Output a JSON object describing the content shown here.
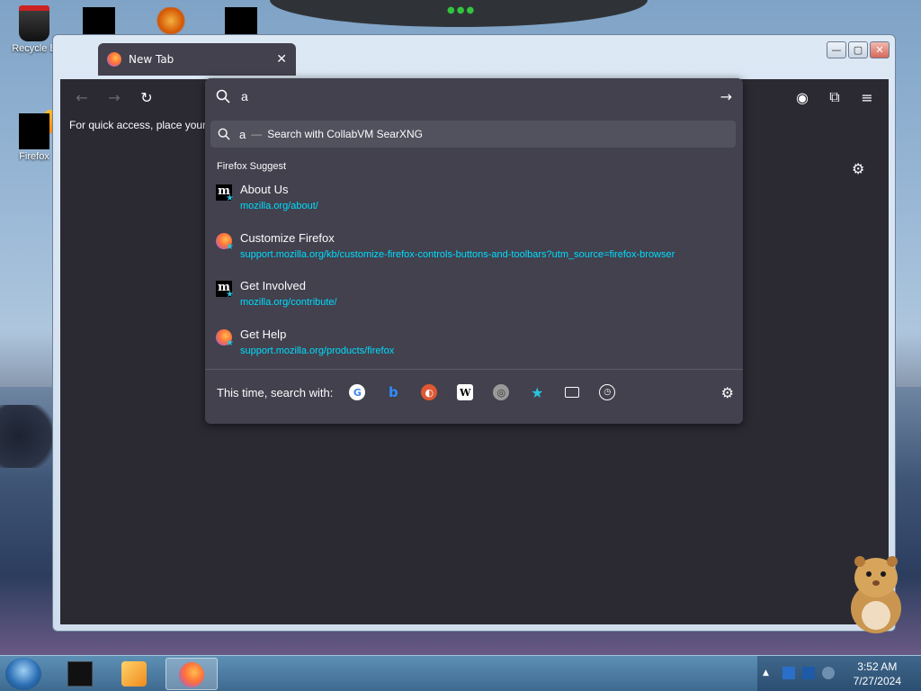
{
  "desktop": {
    "icons": [
      {
        "label": "Recycle B",
        "icon": "recycle-bin-icon"
      },
      {
        "label": "Firefox",
        "icon": "firefox-icon"
      }
    ]
  },
  "window": {
    "tab": {
      "title": "New Tab",
      "close": "✕"
    },
    "controls": {
      "minimize": "—",
      "maximize": "▢",
      "close": "✕"
    }
  },
  "toolbar": {
    "back": "←",
    "forward": "→",
    "reload": "↻",
    "pocket": "◉",
    "extensions": "⧉",
    "menu": "≡"
  },
  "bookmarks_bar": {
    "text": "For quick access, place your b"
  },
  "urlbar": {
    "query": "a",
    "go": "→"
  },
  "search_row": {
    "query": "a",
    "dash": "—",
    "text": "Search with CollabVM SearXNG"
  },
  "suggest": {
    "section_label": "Firefox Suggest",
    "results": [
      {
        "title": "About Us",
        "url": "mozilla.org/about/",
        "icon": "mozilla-icon"
      },
      {
        "title": "Customize Firefox",
        "url": "support.mozilla.org/kb/customize-firefox-controls-buttons-and-toolbars?utm_source=firefox-browser",
        "icon": "firefox-icon"
      },
      {
        "title": "Get Involved",
        "url": "mozilla.org/contribute/",
        "icon": "mozilla-icon"
      },
      {
        "title": "Get Help",
        "url": "support.mozilla.org/products/firefox",
        "icon": "firefox-icon"
      }
    ]
  },
  "search_with": {
    "label": "This time, search with:",
    "engines": [
      {
        "name": "google-icon",
        "glyph": "G"
      },
      {
        "name": "bing-icon",
        "glyph": "b"
      },
      {
        "name": "duckduckgo-icon",
        "glyph": "◐"
      },
      {
        "name": "wikipedia-icon",
        "glyph": "W"
      },
      {
        "name": "searxng-icon",
        "glyph": "◎"
      },
      {
        "name": "bookmarks-icon",
        "glyph": "★"
      },
      {
        "name": "tabs-icon",
        "glyph": ""
      },
      {
        "name": "history-icon",
        "glyph": "◷"
      }
    ]
  },
  "taskbar": {
    "clock": {
      "time": "3:52 AM",
      "date": "7/27/2024"
    }
  },
  "colors": {
    "firefox_bg": "#2b2a33",
    "panel_bg": "#42414d",
    "url_link": "#00ddff",
    "suggest_star": "#2ac3de"
  }
}
